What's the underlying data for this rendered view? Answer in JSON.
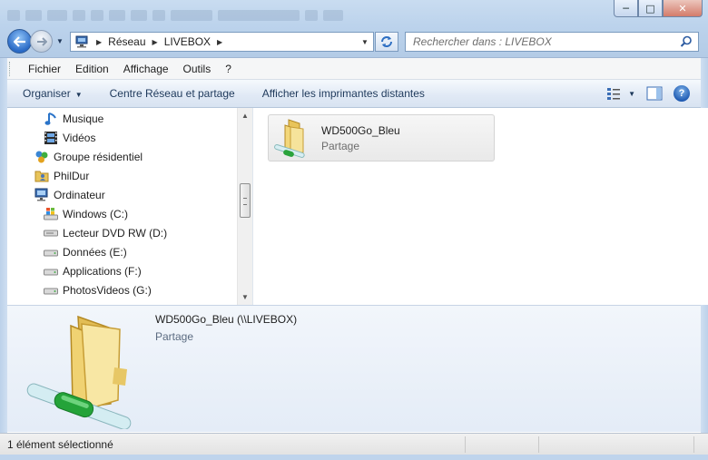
{
  "window": {
    "controls": {
      "minimize": "─",
      "maximize": "□",
      "close": "✕"
    }
  },
  "address_bar": {
    "segments": [
      "Réseau",
      "LIVEBOX"
    ],
    "location_icon": "computer-network-icon"
  },
  "search": {
    "placeholder": "Rechercher dans : LIVEBOX",
    "icon": "search-icon"
  },
  "menu": [
    "Fichier",
    "Edition",
    "Affichage",
    "Outils",
    "?"
  ],
  "commands": {
    "organize": "Organiser",
    "network_center": "Centre Réseau et partage",
    "remote_printers": "Afficher les imprimantes distantes"
  },
  "nav_tree": [
    {
      "label": "Musique",
      "icon": "music-note-icon",
      "level": 2
    },
    {
      "label": "Vidéos",
      "icon": "film-icon",
      "level": 2
    },
    {
      "label": "Groupe résidentiel",
      "icon": "homegroup-icon",
      "level": 1
    },
    {
      "label": "PhilDur",
      "icon": "user-folder-icon",
      "level": 1
    },
    {
      "label": "Ordinateur",
      "icon": "computer-icon",
      "level": 1
    },
    {
      "label": "Windows (C:)",
      "icon": "windows-drive-icon",
      "level": 2
    },
    {
      "label": "Lecteur DVD RW (D:)",
      "icon": "dvd-drive-icon",
      "level": 2
    },
    {
      "label": "Données (E:)",
      "icon": "hard-drive-icon",
      "level": 2
    },
    {
      "label": "Applications (F:)",
      "icon": "hard-drive-icon",
      "level": 2
    },
    {
      "label": "PhotosVideos (G:)",
      "icon": "hard-drive-icon",
      "level": 2
    }
  ],
  "content": {
    "items": [
      {
        "name": "WD500Go_Bleu",
        "type": "Partage",
        "icon": "shared-folder-icon"
      }
    ]
  },
  "details": {
    "name": "WD500Go_Bleu (\\\\LIVEBOX)",
    "type": "Partage",
    "icon": "shared-folder-icon"
  },
  "status": {
    "text": "1 élément sélectionné"
  },
  "colors": {
    "chrome": "#bcd3ec",
    "details_bg": "#e8eff8",
    "accent": "#2a6ac6"
  }
}
